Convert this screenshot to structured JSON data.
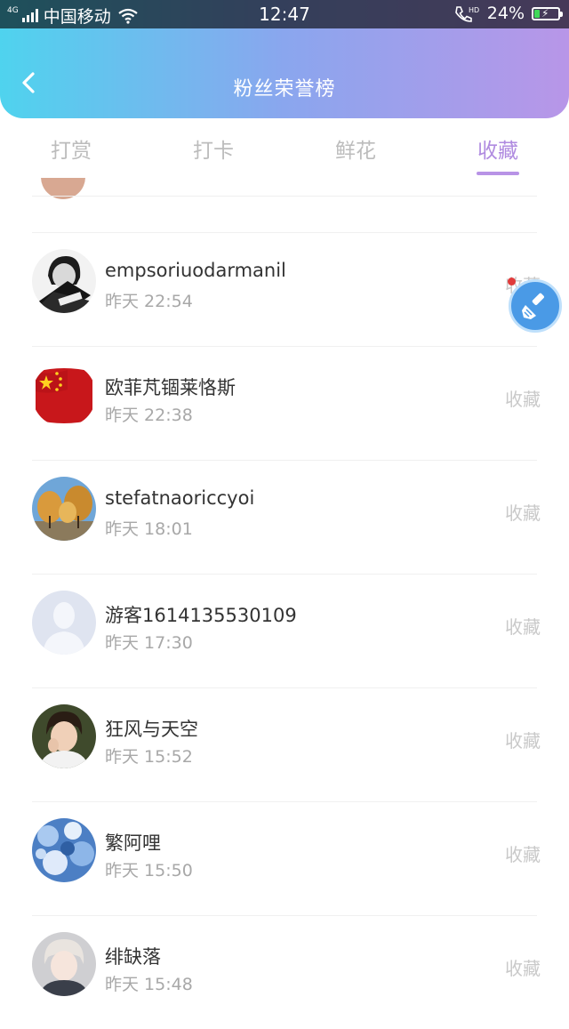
{
  "status_bar": {
    "network": "4G",
    "carrier": "中国移动",
    "time": "12:47",
    "hd_label": "HD",
    "battery_text": "24%",
    "battery_level": 0.24
  },
  "header": {
    "title": "粉丝荣誉榜",
    "back_icon": "chevron-left-icon"
  },
  "tabs": [
    {
      "label": "打赏",
      "active": false
    },
    {
      "label": "打卡",
      "active": false
    },
    {
      "label": "鲜花",
      "active": false
    },
    {
      "label": "收藏",
      "active": true
    }
  ],
  "list": {
    "items": [
      {
        "name": "empsoriuodarmanil",
        "time": "昨天 22:54",
        "action": "收藏",
        "avatar": "black-white-portrait"
      },
      {
        "name": "欧菲芃锢莱恪斯",
        "time": "昨天 22:38",
        "action": "收藏",
        "avatar": "red-flag"
      },
      {
        "name": "stefatnaoriccyoi",
        "time": "昨天 18:01",
        "action": "收藏",
        "avatar": "autumn-trees"
      },
      {
        "name": "游客1614135530109",
        "time": "昨天 17:30",
        "action": "收藏",
        "avatar": "default-user"
      },
      {
        "name": "狂风与天空",
        "time": "昨天 15:52",
        "action": "收藏",
        "avatar": "young-man-portrait"
      },
      {
        "name": "繁阿哩",
        "time": "昨天 15:50",
        "action": "收藏",
        "avatar": "blue-flowers"
      },
      {
        "name": "绯缺落",
        "time": "昨天 15:48",
        "action": "收藏",
        "avatar": "anime-portrait"
      }
    ]
  },
  "floating_button": {
    "icon": "brush-icon",
    "badge_color": "#e03b3b"
  },
  "colors": {
    "header_gradient_start": "#4fd3ee",
    "header_gradient_end": "#b896e8",
    "active_tab": "#b08be0",
    "inactive_tab": "#bcbcbc",
    "float_button": "#4a9ae6"
  }
}
